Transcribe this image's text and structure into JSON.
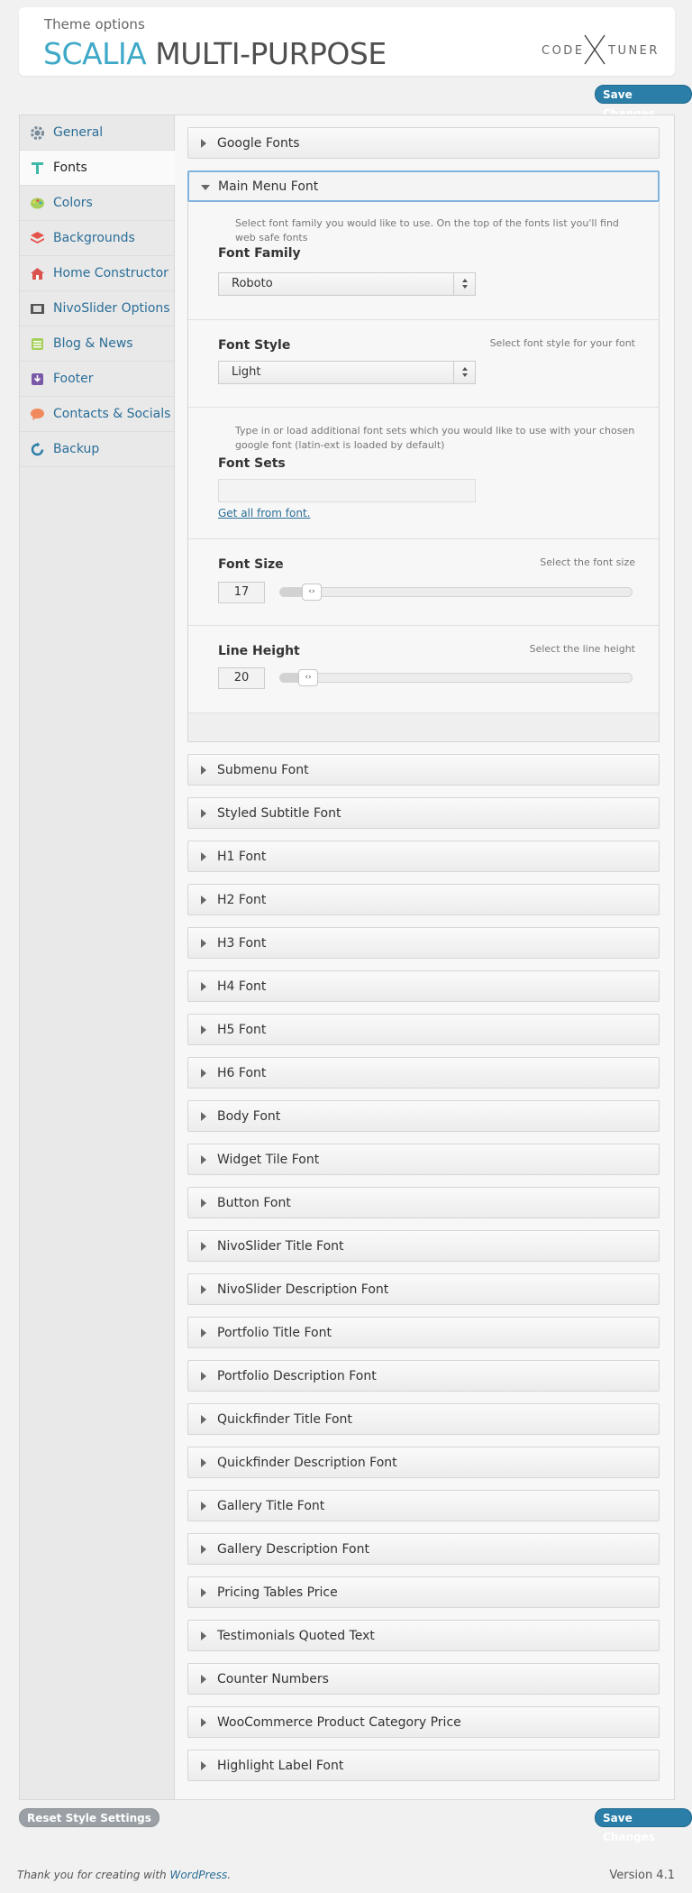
{
  "header": {
    "subtitle": "Theme options",
    "title_part1": "SCALIA",
    "title_part2": "MULTI-PURPOSE",
    "logo_left": "CODE",
    "logo_right": "TUNER"
  },
  "actions": {
    "save_top": "Save Changes",
    "save_bottom": "Save Changes",
    "reset": "Reset Style Settings"
  },
  "sidebar": {
    "items": [
      {
        "label": "General",
        "icon": "gear-icon",
        "color": "#7a8a99"
      },
      {
        "label": "Fonts",
        "icon": "font-icon",
        "color": "#3fb8a8"
      },
      {
        "label": "Colors",
        "icon": "palette-icon",
        "color": "#8bc34a"
      },
      {
        "label": "Backgrounds",
        "icon": "layers-icon",
        "color": "#e5534b"
      },
      {
        "label": "Home Constructor",
        "icon": "home-icon",
        "color": "#d9534f"
      },
      {
        "label": "NivoSlider Options",
        "icon": "film-icon",
        "color": "#555555"
      },
      {
        "label": "Blog & News",
        "icon": "list-icon",
        "color": "#8bc34a"
      },
      {
        "label": "Footer",
        "icon": "footer-icon",
        "color": "#7a5aa8"
      },
      {
        "label": "Contacts & Socials",
        "icon": "chat-icon",
        "color": "#f08a5d"
      },
      {
        "label": "Backup",
        "icon": "refresh-icon",
        "color": "#2a7ea7"
      }
    ]
  },
  "sections": {
    "google_fonts": "Google Fonts",
    "main_menu_font": "Main Menu Font",
    "others": [
      "Submenu Font",
      "Styled Subtitle Font",
      "H1 Font",
      "H2 Font",
      "H3 Font",
      "H4 Font",
      "H5 Font",
      "H6 Font",
      "Body Font",
      "Widget Tile Font",
      "Button Font",
      "NivoSlider Title Font",
      "NivoSlider Description Font",
      "Portfolio Title Font",
      "Portfolio Description Font",
      "Quickfinder Title Font",
      "Quickfinder Description Font",
      "Gallery Title Font",
      "Gallery Description Font",
      "Pricing Tables Price",
      "Testimonials Quoted Text",
      "Counter Numbers",
      "WooCommerce Product Category Price",
      "Highlight Label Font"
    ]
  },
  "main_menu": {
    "family_desc": "Select font family you would like to use. On the top of the fonts list you'll find web safe fonts",
    "family_label": "Font Family",
    "family_value": "Roboto",
    "style_label": "Font Style",
    "style_desc": "Select font style for your font",
    "style_value": "Light",
    "sets_desc": "Type in or load additional font sets which you would like to use with your chosen google font (latin-ext is loaded by default)",
    "sets_label": "Font Sets",
    "sets_value": "",
    "sets_link": "Get all from font.",
    "size_label": "Font Size",
    "size_desc": "Select the font size",
    "size_value": "17",
    "size_level": 0.06,
    "lh_label": "Line Height",
    "lh_desc": "Select the line height",
    "lh_value": "20",
    "lh_level": 0.05
  },
  "footer": {
    "thanks_prefix": "Thank you for creating with",
    "thanks_link": "WordPress",
    "thanks_suffix": ".",
    "version": "Version 4.1"
  }
}
